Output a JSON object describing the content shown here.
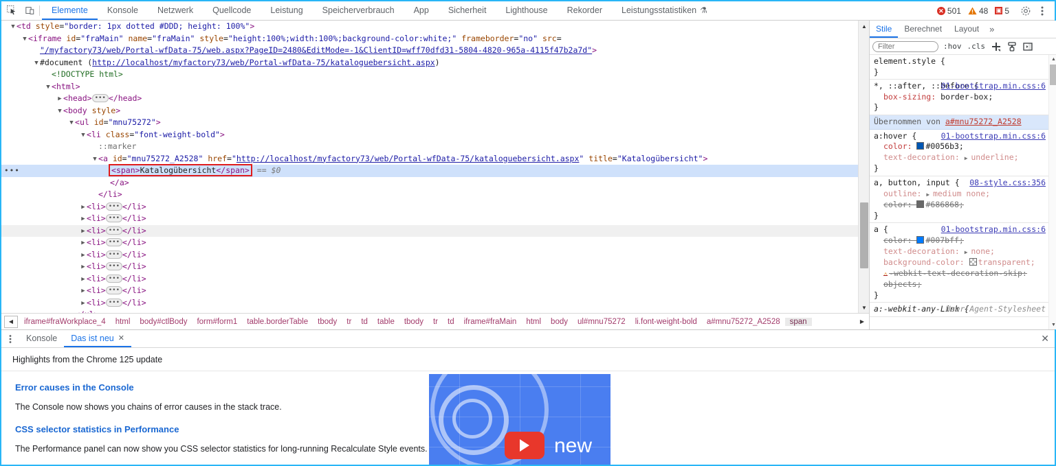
{
  "toolbar": {
    "inspect_icon": "inspect-cursor-icon",
    "device_icon": "device-toolbar-icon",
    "tabs": [
      {
        "label": "Elemente",
        "active": true
      },
      {
        "label": "Konsole",
        "active": false
      },
      {
        "label": "Netzwerk",
        "active": false
      },
      {
        "label": "Quellcode",
        "active": false
      },
      {
        "label": "Leistung",
        "active": false
      },
      {
        "label": "Speicherverbrauch",
        "active": false
      },
      {
        "label": "App",
        "active": false
      },
      {
        "label": "Sicherheit",
        "active": false
      },
      {
        "label": "Lighthouse",
        "active": false
      },
      {
        "label": "Rekorder",
        "active": false
      },
      {
        "label": "Leistungsstatistiken",
        "active": false,
        "flask": "⚗"
      }
    ],
    "errors": "501",
    "warnings": "48",
    "issues": "5",
    "settings_icon": "gear-icon",
    "more_icon": "kebab-menu-icon",
    "error_color": "#d93025",
    "warning_color": "#e37400",
    "accent_color": "#1a73e8"
  },
  "dom": {
    "gutter_dots": "•••",
    "lines": [
      {
        "indent": 0,
        "twisty": "▼",
        "html": "<span class='punct'>&lt;</span><span class='tagname'>td</span> <span class='attrname'>style</span>=<span class='attrval'>\"border: 1px dotted #DDD; height: 100%\"</span><span class='punct'>&gt;</span>"
      },
      {
        "indent": 1,
        "twisty": "▼",
        "html": "<span class='punct'>&lt;</span><span class='tagname'>iframe</span> <span class='attrname'>id</span>=<span class='attrval'>\"fraMain\"</span> <span class='attrname'>name</span>=<span class='attrval'>\"fraMain\"</span> <span class='attrname'>style</span>=<span class='attrval'>\"height:100%;width:100%;background-color:white;\"</span> <span class='attrname'>frameborder</span>=<span class='attrval'>\"no\"</span> <span class='attrname'>src</span>="
      },
      {
        "indent": 2,
        "twisty": "",
        "html": "<span class='attrlink'>\"/myfactory73/web/Portal-wfData-75/web.aspx?PageID=2480&amp;EditMode=-1&amp;ClientID=wff70dfd31-5804-4820-965a-4115f47b2a7d\"</span><span class='punct'>&gt;</span>"
      },
      {
        "indent": 2,
        "twisty": "▼",
        "html": "<span class='text'>#document</span> (<span class='attrlink'>http://localhost/myfactory73/web/Portal-wfData-75/kataloguebersicht.aspx</span>)"
      },
      {
        "indent": 3,
        "twisty": "",
        "html": "<span class='comment'>&lt;!DOCTYPE html&gt;</span>"
      },
      {
        "indent": 3,
        "twisty": "▼",
        "html": "<span class='punct'>&lt;</span><span class='tagname'>html</span><span class='punct'>&gt;</span>"
      },
      {
        "indent": 4,
        "twisty": "▶",
        "html": "<span class='punct'>&lt;</span><span class='tagname'>head</span><span class='punct'>&gt;</span><span class='ellipsis'>•••</span><span class='punct'>&lt;/</span><span class='tagname'>head</span><span class='punct'>&gt;</span>"
      },
      {
        "indent": 4,
        "twisty": "▼",
        "html": "<span class='punct'>&lt;</span><span class='tagname'>body</span> <span class='attrname'>style</span><span class='punct'>&gt;</span>"
      },
      {
        "indent": 5,
        "twisty": "▼",
        "html": "<span class='punct'>&lt;</span><span class='tagname'>ul</span> <span class='attrname'>id</span>=<span class='attrval'>\"mnu75272\"</span><span class='punct'>&gt;</span>"
      },
      {
        "indent": 6,
        "twisty": "▼",
        "html": "<span class='punct'>&lt;</span><span class='tagname'>li</span> <span class='attrname'>class</span>=<span class='attrval'>\"font-weight-bold\"</span><span class='punct'>&gt;</span>"
      },
      {
        "indent": 7,
        "twisty": "",
        "html": "<span class='pseudo'>::marker</span>"
      },
      {
        "indent": 7,
        "twisty": "▼",
        "html": "<span class='punct'>&lt;</span><span class='tagname'>a</span> <span class='attrname'>id</span>=<span class='attrval'>\"mnu75272_A2528\"</span> <span class='attrname'>href</span>=<span class='attrval'>\"</span><span class='attrlink'>http://localhost/myfactory73/web/Portal-wfData-75/kataloguebersicht.aspx</span><span class='attrval'>\"</span> <span class='attrname'>title</span>=<span class='attrval'>\"Katalogübersicht\"</span><span class='punct'>&gt;</span>"
      },
      {
        "indent": 8,
        "twisty": "",
        "selected": true,
        "html": "<span class='sel-box'><span class='punct'>&lt;</span><span class='tagname'>span</span><span class='punct'>&gt;</span><span class='text'>Katalogübersicht</span><span class='punct'>&lt;/</span><span class='tagname'>span</span><span class='punct'>&gt;</span></span> <span class='dollar'>== $0</span>"
      },
      {
        "indent": 8,
        "twisty": "",
        "html": "<span class='punct'>&lt;/</span><span class='tagname'>a</span><span class='punct'>&gt;</span>"
      },
      {
        "indent": 7,
        "twisty": "",
        "html": "<span class='punct'>&lt;/</span><span class='tagname'>li</span><span class='punct'>&gt;</span>"
      },
      {
        "indent": 6,
        "twisty": "▶",
        "html": "<span class='punct'>&lt;</span><span class='tagname'>li</span><span class='punct'>&gt;</span><span class='ellipsis'>•••</span><span class='punct'>&lt;/</span><span class='tagname'>li</span><span class='punct'>&gt;</span>"
      },
      {
        "indent": 6,
        "twisty": "▶",
        "html": "<span class='punct'>&lt;</span><span class='tagname'>li</span><span class='punct'>&gt;</span><span class='ellipsis'>•••</span><span class='punct'>&lt;/</span><span class='tagname'>li</span><span class='punct'>&gt;</span>"
      },
      {
        "indent": 6,
        "twisty": "▶",
        "hovered": true,
        "html": "<span class='punct'>&lt;</span><span class='tagname'>li</span><span class='punct'>&gt;</span><span class='ellipsis'>•••</span><span class='punct'>&lt;/</span><span class='tagname'>li</span><span class='punct'>&gt;</span>"
      },
      {
        "indent": 6,
        "twisty": "▶",
        "html": "<span class='punct'>&lt;</span><span class='tagname'>li</span><span class='punct'>&gt;</span><span class='ellipsis'>•••</span><span class='punct'>&lt;/</span><span class='tagname'>li</span><span class='punct'>&gt;</span>"
      },
      {
        "indent": 6,
        "twisty": "▶",
        "html": "<span class='punct'>&lt;</span><span class='tagname'>li</span><span class='punct'>&gt;</span><span class='ellipsis'>•••</span><span class='punct'>&lt;/</span><span class='tagname'>li</span><span class='punct'>&gt;</span>"
      },
      {
        "indent": 6,
        "twisty": "▶",
        "html": "<span class='punct'>&lt;</span><span class='tagname'>li</span><span class='punct'>&gt;</span><span class='ellipsis'>•••</span><span class='punct'>&lt;/</span><span class='tagname'>li</span><span class='punct'>&gt;</span>"
      },
      {
        "indent": 6,
        "twisty": "▶",
        "html": "<span class='punct'>&lt;</span><span class='tagname'>li</span><span class='punct'>&gt;</span><span class='ellipsis'>•••</span><span class='punct'>&lt;/</span><span class='tagname'>li</span><span class='punct'>&gt;</span>"
      },
      {
        "indent": 6,
        "twisty": "▶",
        "html": "<span class='punct'>&lt;</span><span class='tagname'>li</span><span class='punct'>&gt;</span><span class='ellipsis'>•••</span><span class='punct'>&lt;/</span><span class='tagname'>li</span><span class='punct'>&gt;</span>"
      },
      {
        "indent": 6,
        "twisty": "▶",
        "html": "<span class='punct'>&lt;</span><span class='tagname'>li</span><span class='punct'>&gt;</span><span class='ellipsis'>•••</span><span class='punct'>&lt;/</span><span class='tagname'>li</span><span class='punct'>&gt;</span>"
      },
      {
        "indent": 5,
        "twisty": "",
        "html": "<span class='punct'>&lt;/</span><span class='tagname'>ul</span><span class='punct'>&gt;</span>"
      }
    ],
    "selected_text": "Katalogübersicht",
    "highlight_color": "#e01b1b"
  },
  "breadcrumb": {
    "scroll_left_icon": "chevron-left-icon",
    "items": [
      "iframe#fraWorkplace_4",
      "html",
      "body#ctlBody",
      "form#form1",
      "table.borderTable",
      "tbody",
      "tr",
      "td",
      "table",
      "tbody",
      "tr",
      "td",
      "iframe#fraMain",
      "html",
      "body",
      "ul#mnu75272",
      "li.font-weight-bold",
      "a#mnu75272_A2528",
      "span"
    ],
    "active_index": 18,
    "scroll_right_icon": "chevron-right-icon"
  },
  "styles": {
    "tabs": [
      {
        "label": "Stile",
        "active": true
      },
      {
        "label": "Berechnet",
        "active": false
      },
      {
        "label": "Layout",
        "active": false
      }
    ],
    "more_tabs_icon": "chevrons-right-icon",
    "filter_placeholder": "Filter",
    "filter_value": "",
    "hov_label": ":hov",
    "cls_label": ".cls",
    "new_rule_icon": "plus-icon",
    "class_style_icon": "paint-brush-icon",
    "toggle_sidebar_icon": "toggle-panel-icon",
    "inherited_label": "Übernommen von",
    "inherited_selector": "a#mnu75272_A2528",
    "rules": [
      {
        "selector": "element.style {",
        "origin": "",
        "close": "}",
        "props": []
      },
      {
        "selector": "*, ::after, ::before {",
        "origin": "01-bootstrap.min.css:6",
        "close": "}",
        "props": [
          {
            "name": "box-sizing",
            "value": "border-box;",
            "state": "normal"
          }
        ]
      },
      {
        "selector": "a:hover {",
        "origin": "01-bootstrap.min.css:6",
        "close": "}",
        "props": [
          {
            "name": "color",
            "value": "#0056b3;",
            "state": "normal",
            "swatch": "#0056b3"
          },
          {
            "name": "text-decoration",
            "value": "underline;",
            "state": "inactive",
            "expand": "▶"
          }
        ]
      },
      {
        "selector": "a, button, input {",
        "origin": "08-style.css:356",
        "close": "}",
        "props": [
          {
            "name": "outline",
            "value": "medium none;",
            "state": "inactive",
            "expand": "▶"
          },
          {
            "name": "color",
            "value": "#686868;",
            "state": "struck",
            "swatch": "#686868"
          }
        ]
      },
      {
        "selector": "a {",
        "origin": "01-bootstrap.min.css:6",
        "close": "}",
        "props": [
          {
            "name": "color",
            "value": "#007bff;",
            "state": "struck",
            "swatch": "#007bff"
          },
          {
            "name": "text-decoration",
            "value": "none;",
            "state": "inactive",
            "expand": "▶"
          },
          {
            "name": "background-color",
            "value": "transparent;",
            "state": "inactive",
            "swatch": "transparent"
          },
          {
            "name": "-webkit-text-decoration-skip",
            "value": "objects;",
            "state": "struck",
            "warn": "⚠"
          }
        ]
      },
      {
        "selector": "a:-webkit-any-Link {",
        "origin": "User-Agent-Stylesheet",
        "origin_ua": true,
        "close": "",
        "props": []
      }
    ]
  },
  "drawer": {
    "menu_icon": "kebab-menu-icon",
    "tabs": [
      {
        "label": "Konsole",
        "active": false,
        "closable": false
      },
      {
        "label": "Das ist neu",
        "active": true,
        "closable": true,
        "close_icon": "close-icon"
      }
    ],
    "close_drawer_icon": "close-icon",
    "heading": "Highlights from the Chrome 125 update",
    "sections": [
      {
        "title": "Error causes in the Console",
        "body": "The Console now shows you chains of error causes in the stack trace."
      },
      {
        "title": "CSS selector statistics in Performance",
        "body": "The Performance panel can now show you CSS selector statistics for long-running Recalculate Style events."
      }
    ],
    "thumbnail": {
      "name": "chrome-devtools-whats-new-video-thumbnail",
      "caption": "new",
      "background_color": "#4a7ef0",
      "play_button_color": "#e8372b"
    },
    "link_color": "#1967d2"
  }
}
